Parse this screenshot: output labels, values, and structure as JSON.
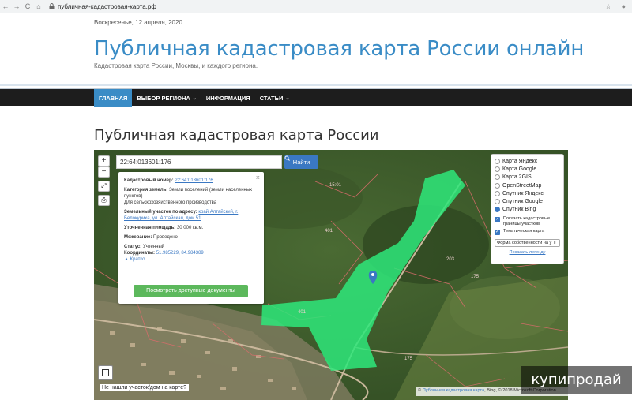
{
  "browser": {
    "url": "публичная-кадастровая-карта.рф",
    "back": "←",
    "forward": "→",
    "reload": "C",
    "home": "⌂",
    "star": "☆"
  },
  "header": {
    "date": "Воскресенье, 12 апреля, 2020",
    "title": "Публичная кадастровая карта России онлайн",
    "subtitle": "Кадастровая карта России, Москвы, и каждого региона."
  },
  "nav": {
    "items": [
      {
        "label": "Главная",
        "active": true
      },
      {
        "label": "Выбор региона",
        "dropdown": true
      },
      {
        "label": "Информация"
      },
      {
        "label": "Статьи",
        "dropdown": true
      }
    ]
  },
  "page_title": "Публичная кадастровая карта России",
  "map": {
    "zoom_in": "+",
    "zoom_out": "−",
    "search_value": "22:64:013601:176",
    "search_button": "Найти",
    "info": {
      "cadastral_label": "Кадастровый номер:",
      "cadastral_value": "22:64:013601:176",
      "category_label": "Категория земель:",
      "category_value": "Земли поселений (земли населенных пунктов)",
      "usage_value": "Для сельскохозяйственного производства",
      "address_label": "Земельный участок по адресу:",
      "address_value": "край Алтайский, г. Белокуриха, ул. Алтайская, дом 51",
      "area_label": "Уточненная площадь:",
      "area_value": "30 000 кв.м.",
      "survey_label": "Межевание:",
      "survey_value": "Проведено",
      "status_label": "Статус:",
      "status_value": "Учтенный",
      "coords_label": "Координаты:",
      "coords_value": "51.985229, 84.984389",
      "short_link": "▲ Кратко",
      "docs_button": "Посмотреть доступные документы",
      "close": "×"
    },
    "layers": [
      {
        "label": "Карта Яндекс",
        "selected": false
      },
      {
        "label": "Карта Google",
        "selected": false
      },
      {
        "label": "Карта 2GIS",
        "selected": false
      },
      {
        "label": "OpenStreetMap",
        "selected": false
      },
      {
        "label": "Спутник Яндекс",
        "selected": false
      },
      {
        "label": "Спутник Google",
        "selected": false
      },
      {
        "label": "Спутник Bing",
        "selected": true
      }
    ],
    "checkbox_borders": "Показать кадастровые границы участков",
    "checkbox_thematic": "Тематическая карта",
    "select_value": "Форма собственности на у",
    "legend_link": "Показать легенду",
    "not_found": "Не нашли участок/дом на карте?",
    "attribution_prefix": "©",
    "attribution_link": "Публичная кадастровая карта",
    "attribution_rest": ", Bing, © 2018 Microsoft Corporation",
    "labels": [
      "15:01",
      "401",
      "203",
      "175",
      "401",
      "175"
    ]
  },
  "watermark": "купипродай",
  "colors": {
    "accent": "#3a8cc6",
    "navbar": "#1d1d1d",
    "parcel": "#2ee87a",
    "docs_button": "#5cb85c"
  }
}
